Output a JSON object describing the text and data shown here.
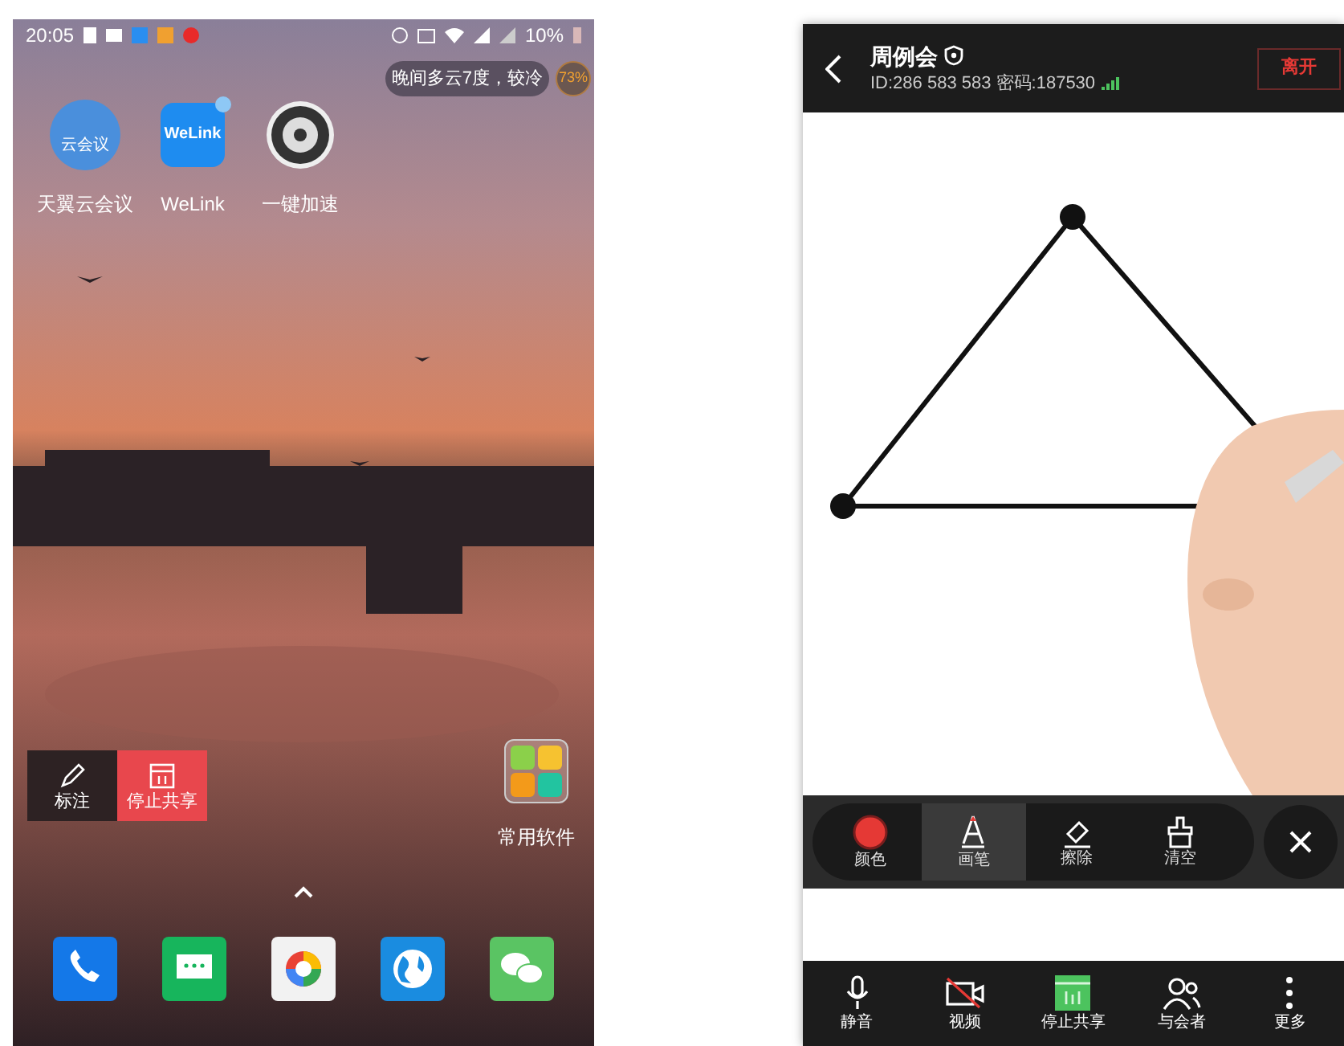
{
  "home_screen": {
    "status_bar": {
      "time": "20:05",
      "battery": "10%"
    },
    "weather": {
      "text": "晚间多云7度，较冷",
      "badge": "73%"
    },
    "apps": [
      {
        "label": "天翼云会议",
        "kind": "cloud",
        "icon_text": "云会议"
      },
      {
        "label": "WeLink",
        "kind": "welink",
        "icon_text": "WeLink",
        "dot": true
      },
      {
        "label": "一键加速",
        "kind": "boost"
      }
    ],
    "share_controls": [
      {
        "label": "标注",
        "kind": "annotate"
      },
      {
        "label": "停止共享",
        "kind": "stop"
      }
    ],
    "folder": {
      "label": "常用软件"
    },
    "dock": [
      {
        "kind": "phone"
      },
      {
        "kind": "messages"
      },
      {
        "kind": "camera"
      },
      {
        "kind": "browser"
      },
      {
        "kind": "chat"
      }
    ]
  },
  "meeting": {
    "title": "周例会",
    "info": "ID:286 583 583 密码:187530",
    "leave_button": "离开",
    "tools": [
      {
        "label": "颜色",
        "kind": "color",
        "selected": false
      },
      {
        "label": "画笔",
        "kind": "pen",
        "selected": true
      },
      {
        "label": "擦除",
        "kind": "eraser",
        "selected": false
      },
      {
        "label": "清空",
        "kind": "clear",
        "selected": false
      }
    ],
    "bottom_bar": [
      {
        "label": "静音",
        "kind": "mic"
      },
      {
        "label": "视频",
        "kind": "video"
      },
      {
        "label": "停止共享",
        "kind": "share"
      },
      {
        "label": "与会者",
        "kind": "people"
      },
      {
        "label": "更多",
        "kind": "more"
      }
    ]
  }
}
